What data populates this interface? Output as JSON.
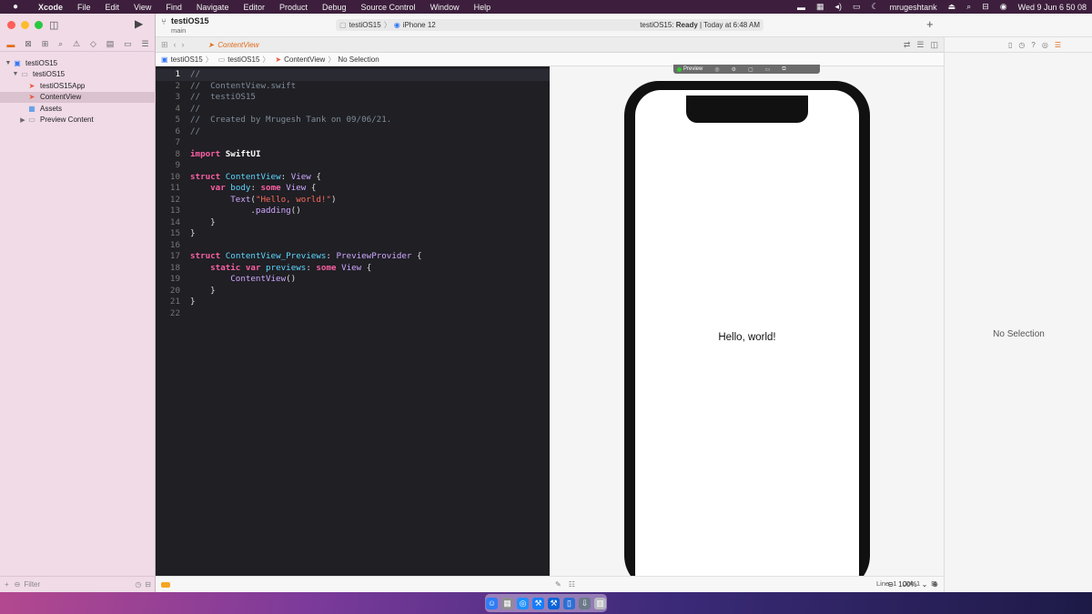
{
  "menubar": {
    "apple_icon": "apple-icon",
    "items": [
      "Xcode",
      "File",
      "Edit",
      "View",
      "Find",
      "Navigate",
      "Editor",
      "Product",
      "Debug",
      "Source Control",
      "Window",
      "Help"
    ],
    "user": "mrugeshtank",
    "datetime": "Wed 9 Jun  6 50 08"
  },
  "toolbar": {
    "project": "testiOS15",
    "branch": "main",
    "scheme": "testiOS15",
    "device": "iPhone 12",
    "status_prefix": "testiOS15: ",
    "status_bold": "Ready",
    "status_suffix": " | Today at 6:48 AM"
  },
  "navigator": {
    "items": [
      {
        "label": "testiOS15",
        "level": 0,
        "expanded": true,
        "icon": "project-icon"
      },
      {
        "label": "testiOS15",
        "level": 1,
        "expanded": true,
        "icon": "folder-icon"
      },
      {
        "label": "testiOS15App",
        "level": 2,
        "icon": "swift-file-icon"
      },
      {
        "label": "ContentView",
        "level": 2,
        "icon": "swift-file-icon",
        "selected": true
      },
      {
        "label": "Assets",
        "level": 2,
        "icon": "assets-icon"
      },
      {
        "label": "Preview Content",
        "level": 2,
        "expanded": false,
        "icon": "folder-icon"
      }
    ],
    "filter_placeholder": "Filter"
  },
  "tab": {
    "label": "ContentView"
  },
  "breadcrumb": {
    "items": [
      "testiOS15",
      "testiOS15",
      "ContentView",
      "No Selection"
    ]
  },
  "editor": {
    "current_line": 1,
    "lines": [
      [
        [
          "//",
          "comment"
        ]
      ],
      [
        [
          "//  ContentView.swift",
          "comment"
        ]
      ],
      [
        [
          "//  testiOS15",
          "comment"
        ]
      ],
      [
        [
          "//",
          "comment"
        ]
      ],
      [
        [
          "//  Created by Mrugesh Tank on 09/06/21.",
          "comment"
        ]
      ],
      [
        [
          "//",
          "comment"
        ]
      ],
      [],
      [
        [
          "import",
          "kw"
        ],
        [
          " ",
          "plain"
        ],
        [
          "SwiftUI",
          "bold"
        ]
      ],
      [],
      [
        [
          "struct",
          "kw"
        ],
        [
          " ",
          "plain"
        ],
        [
          "ContentView",
          "type"
        ],
        [
          ": ",
          "plain"
        ],
        [
          "View",
          "fn"
        ],
        [
          " {",
          "plain"
        ]
      ],
      [
        [
          "    ",
          "plain"
        ],
        [
          "var",
          "kw"
        ],
        [
          " ",
          "plain"
        ],
        [
          "body",
          "type"
        ],
        [
          ": ",
          "plain"
        ],
        [
          "some",
          "kw"
        ],
        [
          " ",
          "plain"
        ],
        [
          "View",
          "fn"
        ],
        [
          " {",
          "plain"
        ]
      ],
      [
        [
          "        ",
          "plain"
        ],
        [
          "Text",
          "fn"
        ],
        [
          "(",
          "plain"
        ],
        [
          "\"Hello, world!\"",
          "str"
        ],
        [
          ")",
          "plain"
        ]
      ],
      [
        [
          "            .",
          "plain"
        ],
        [
          "padding",
          "fn"
        ],
        [
          "()",
          "plain"
        ]
      ],
      [
        [
          "    }",
          "plain"
        ]
      ],
      [
        [
          "}",
          "plain"
        ]
      ],
      [],
      [
        [
          "struct",
          "kw"
        ],
        [
          " ",
          "plain"
        ],
        [
          "ContentView_Previews",
          "type"
        ],
        [
          ": ",
          "plain"
        ],
        [
          "PreviewProvider",
          "fn"
        ],
        [
          " {",
          "plain"
        ]
      ],
      [
        [
          "    ",
          "plain"
        ],
        [
          "static",
          "kw"
        ],
        [
          " ",
          "plain"
        ],
        [
          "var",
          "kw"
        ],
        [
          " ",
          "plain"
        ],
        [
          "previews",
          "type"
        ],
        [
          ": ",
          "plain"
        ],
        [
          "some",
          "kw"
        ],
        [
          " ",
          "plain"
        ],
        [
          "View",
          "fn"
        ],
        [
          " {",
          "plain"
        ]
      ],
      [
        [
          "        ",
          "plain"
        ],
        [
          "ContentView",
          "fn"
        ],
        [
          "()",
          "plain"
        ]
      ],
      [
        [
          "    }",
          "plain"
        ]
      ],
      [
        [
          "}",
          "plain"
        ]
      ],
      []
    ]
  },
  "preview": {
    "live_label": "Preview",
    "text": "Hello, world!",
    "zoom": "100%"
  },
  "status_bar": {
    "line": "Line: 1",
    "col": "Col: 1"
  },
  "inspector": {
    "empty_label": "No Selection"
  },
  "colors": {
    "accent": "#e26b1a",
    "keyword": "#fc5fa3",
    "type": "#5dd8ff",
    "string": "#fc6a5d",
    "comment": "#7f8c98"
  }
}
